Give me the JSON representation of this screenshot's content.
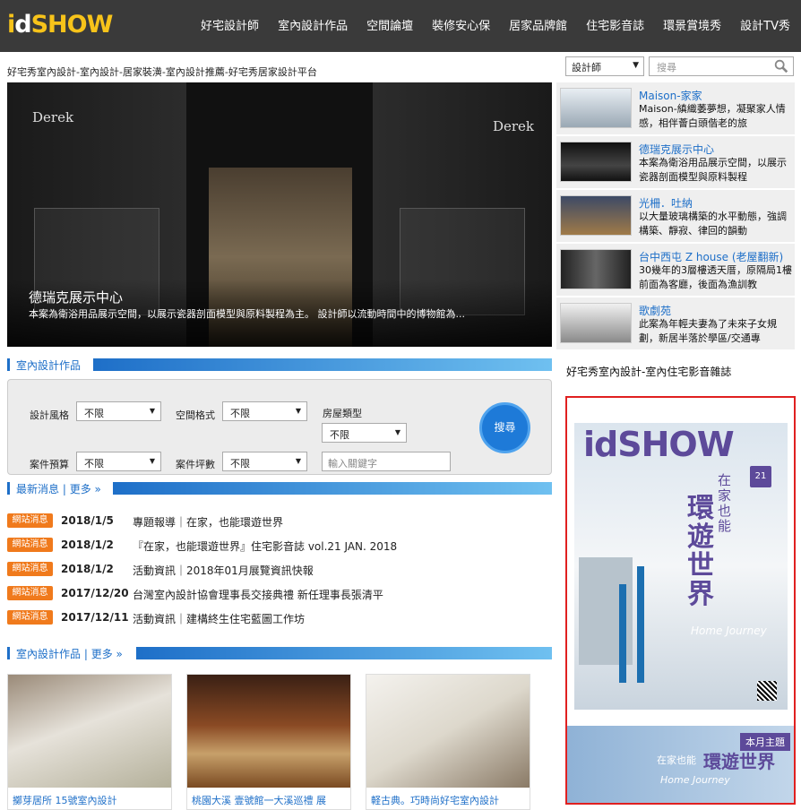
{
  "header": {
    "logo_i": "i",
    "logo_d": "d",
    "logo_show": "SHOW",
    "nav": [
      "好宅設計師",
      "室內設計作品",
      "空間論壇",
      "裝修安心保",
      "居家品牌館",
      "住宅影音誌",
      "環景賞境秀",
      "設計TV秀"
    ]
  },
  "breadcrumb": "好宅秀室內設計-室內設計-居家裝潢-室內設計推薦-好宅秀居家設計平台",
  "search": {
    "select_value": "設計師",
    "placeholder": "搜尋"
  },
  "hero": {
    "brand_left": "Derek",
    "brand_right": "Derek",
    "title": "德瑞克展示中心",
    "desc": "本案為衛浴用品展示空間，以展示瓷器剖面模型與原料製程為主。 設計師以流動時間中的博物館為..."
  },
  "side_items": [
    {
      "title": "Maison-家家",
      "desc": "Maison-縝織萎夢想，凝聚家人情感，相伴薈白頭偕老的旅"
    },
    {
      "title": "德瑞克展示中心",
      "desc": "本案為衛浴用品展示空間，以展示瓷器剖面模型與原料製程"
    },
    {
      "title": "光柵．吐納",
      "desc": "以大量玻璃構築的水平動態，強調構築、靜寂、律回的韻動"
    },
    {
      "title": "台中西屯 Z house (老屋翻新)",
      "desc": "30幾年的3層樓透天厝，原隔局1樓前面為客廳，後面為漁訓教"
    },
    {
      "title": "歌劇苑",
      "desc": "此案為年輕夫妻為了未來子女規劃，新居半落於學區/交通專"
    }
  ],
  "section_works": {
    "label": "室內設計作品"
  },
  "filter": {
    "style_label": "設計風格",
    "style_value": "不限",
    "space_label": "空間格式",
    "space_value": "不限",
    "house_label": "房屋類型",
    "house_value": "不限",
    "budget_label": "案件預算",
    "budget_value": "不限",
    "area_label": "案件坪數",
    "area_value": "不限",
    "keyword_placeholder": "輸入關鍵字",
    "search_button": "搜尋"
  },
  "section_news": {
    "label": "最新消息",
    "sep": "|",
    "more": "更多 »"
  },
  "news": [
    {
      "tag": "網站消息",
      "date": "2018/1/5",
      "text": "專題報導｜在家，也能環遊世界"
    },
    {
      "tag": "網站消息",
      "date": "2018/1/2",
      "text": "『在家，也能環遊世界』住宅影音誌 vol.21 JAN. 2018"
    },
    {
      "tag": "網站消息",
      "date": "2018/1/2",
      "text": "活動資訊｜2018年01月展覽資訊快報"
    },
    {
      "tag": "網站消息",
      "date": "2017/12/20",
      "text": "台灣室內設計協會理事長交接典禮 新任理事長張清平"
    },
    {
      "tag": "網站消息",
      "date": "2017/12/11",
      "text": "活動資訊｜建構終生住宅藍圖工作坊"
    }
  ],
  "section_works2": {
    "label": "室內設計作品",
    "sep": "|",
    "more": "更多 »"
  },
  "cards": [
    {
      "title": "擲芽居所 15號室內設計"
    },
    {
      "title": "桃園大溪 壹號館一大溪巡禮 展"
    },
    {
      "title": "軽古典。巧時尚好宅室內設計"
    }
  ],
  "magazine": {
    "title": "好宅秀室內設計-室內住宅影音雜誌",
    "cover_logo": "idSHOW",
    "cover_issue": "21",
    "cover_headline": "環遊世界",
    "cover_sub": "在家也能",
    "cover_eng": "Home Journey",
    "banner_tag": "本月主題",
    "banner_small": "在家也能",
    "banner_big": "環遊世界",
    "banner_eng": "Home Journey"
  }
}
